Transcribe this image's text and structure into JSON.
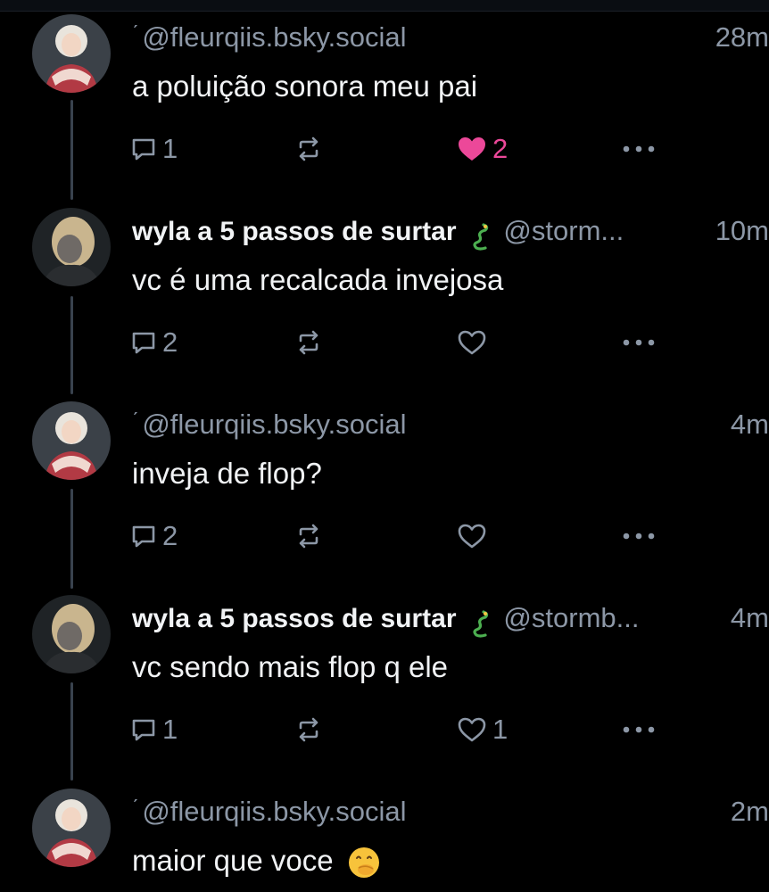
{
  "colors": {
    "background": "#000000",
    "text": "#f1f3f5",
    "muted": "#8c97a6",
    "like_active": "#ec4899",
    "thread_line": "#39424e"
  },
  "icons": {
    "reply": "speech-bubble-icon",
    "repost": "repost-arrows-icon",
    "like": "heart-icon",
    "more": "ellipsis-icon",
    "dragon": "dragon-emoji",
    "hand_over_mouth": "face-with-hand-over-mouth-emoji"
  },
  "posts": [
    {
      "name": "",
      "handle": "@fleurqiis.bsky.social",
      "time": "28m",
      "text": "a poluição sonora meu pai",
      "replies": "1",
      "reposts": "",
      "likes": "2",
      "liked": true,
      "more": "•••"
    },
    {
      "name": "wyla a 5 passos de surtar",
      "handle": "@storm...",
      "time": "10m",
      "text": "vc é uma recalcada invejosa",
      "replies": "2",
      "reposts": "",
      "likes": "",
      "liked": false,
      "more": "•••"
    },
    {
      "name": "",
      "handle": "@fleurqiis.bsky.social",
      "time": "4m",
      "text": "inveja de flop?",
      "replies": "2",
      "reposts": "",
      "likes": "",
      "liked": false,
      "more": "•••"
    },
    {
      "name": "wyla a 5 passos de surtar",
      "handle": "@stormb...",
      "time": "4m",
      "text": "vc sendo mais flop q ele",
      "replies": "1",
      "reposts": "",
      "likes": "1",
      "liked": false,
      "more": "•••"
    },
    {
      "name": "",
      "handle": "@fleurqiis.bsky.social",
      "time": "2m",
      "text": "maior que voce",
      "replies": "",
      "reposts": "",
      "likes": "",
      "liked": false,
      "more": ""
    }
  ]
}
